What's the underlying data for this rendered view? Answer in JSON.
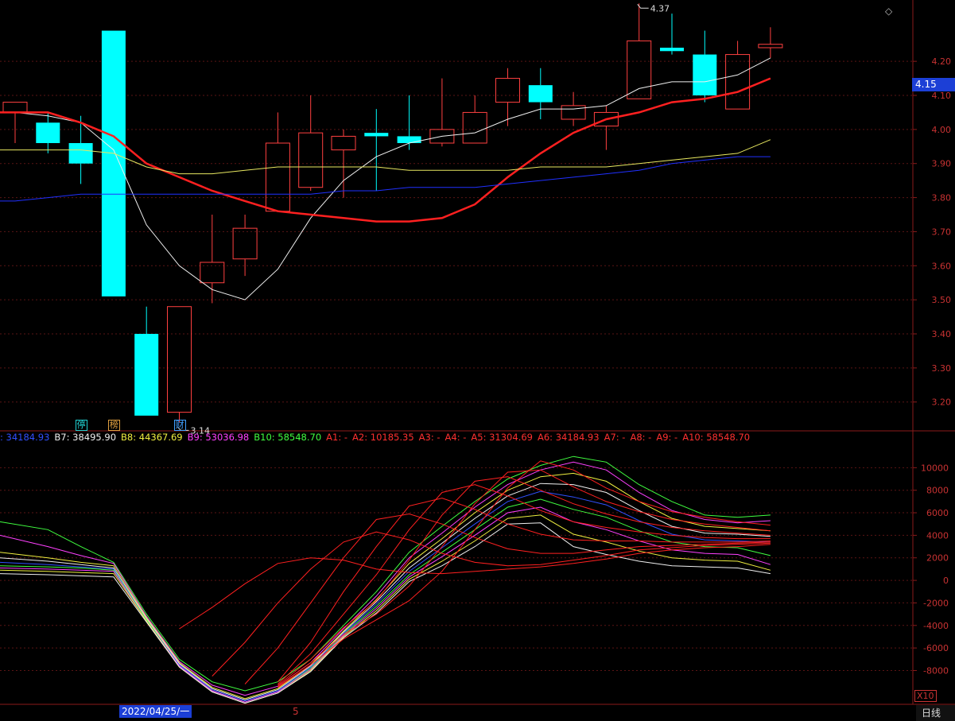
{
  "chart_data": [
    {
      "type": "candlestick",
      "y_ticks": [
        "4.20",
        "4.10",
        "4.00",
        "3.90",
        "3.80",
        "3.70",
        "3.60",
        "3.50",
        "3.40",
        "3.30",
        "3.20"
      ],
      "ylim": [
        3.12,
        4.38
      ],
      "current_price": "4.15",
      "high_label": "4.37",
      "low_label": "3.14",
      "candles": [
        {
          "o": 4.05,
          "h": 4.08,
          "l": 3.96,
          "c": 4.08,
          "up": true
        },
        {
          "o": 4.02,
          "h": 4.05,
          "l": 3.93,
          "c": 3.96,
          "up": false
        },
        {
          "o": 3.96,
          "h": 4.04,
          "l": 3.84,
          "c": 3.9,
          "up": false
        },
        {
          "o": 4.29,
          "h": 4.29,
          "l": 3.51,
          "c": 3.51,
          "up": false
        },
        {
          "o": 3.4,
          "h": 3.48,
          "l": 3.16,
          "c": 3.16,
          "up": false
        },
        {
          "o": 3.17,
          "h": 3.48,
          "l": 3.14,
          "c": 3.48,
          "up": true
        },
        {
          "o": 3.55,
          "h": 3.75,
          "l": 3.49,
          "c": 3.61,
          "up": true
        },
        {
          "o": 3.62,
          "h": 3.75,
          "l": 3.57,
          "c": 3.71,
          "up": true
        },
        {
          "o": 3.76,
          "h": 4.05,
          "l": 3.76,
          "c": 3.96,
          "up": true
        },
        {
          "o": 3.83,
          "h": 4.1,
          "l": 3.82,
          "c": 3.99,
          "up": true
        },
        {
          "o": 3.94,
          "h": 4.0,
          "l": 3.8,
          "c": 3.98,
          "up": true
        },
        {
          "o": 3.99,
          "h": 4.06,
          "l": 3.82,
          "c": 3.98,
          "up": false
        },
        {
          "o": 3.98,
          "h": 4.1,
          "l": 3.94,
          "c": 3.96,
          "up": false
        },
        {
          "o": 3.96,
          "h": 4.15,
          "l": 3.95,
          "c": 4.0,
          "up": true
        },
        {
          "o": 3.96,
          "h": 4.1,
          "l": 3.96,
          "c": 4.05,
          "up": true
        },
        {
          "o": 4.08,
          "h": 4.18,
          "l": 4.01,
          "c": 4.15,
          "up": true
        },
        {
          "o": 4.13,
          "h": 4.18,
          "l": 4.03,
          "c": 4.08,
          "up": false
        },
        {
          "o": 4.03,
          "h": 4.11,
          "l": 4.01,
          "c": 4.07,
          "up": true
        },
        {
          "o": 4.01,
          "h": 4.07,
          "l": 3.94,
          "c": 4.05,
          "up": true
        },
        {
          "o": 4.09,
          "h": 4.37,
          "l": 4.09,
          "c": 4.26,
          "up": true
        },
        {
          "o": 4.24,
          "h": 4.34,
          "l": 4.22,
          "c": 4.23,
          "up": false
        },
        {
          "o": 4.22,
          "h": 4.29,
          "l": 4.08,
          "c": 4.1,
          "up": false
        },
        {
          "o": 4.06,
          "h": 4.26,
          "l": 4.06,
          "c": 4.22,
          "up": true
        },
        {
          "o": 4.24,
          "h": 4.3,
          "l": 4.21,
          "c": 4.25,
          "up": true
        }
      ],
      "ma": [
        {
          "color": "#f0f0f0",
          "width": 1,
          "values": [
            4.05,
            4.04,
            4.02,
            3.94,
            3.72,
            3.6,
            3.53,
            3.5,
            3.59,
            3.74,
            3.85,
            3.92,
            3.96,
            3.98,
            3.99,
            4.03,
            4.06,
            4.06,
            4.07,
            4.12,
            4.14,
            4.14,
            4.16,
            4.21
          ]
        },
        {
          "color": "#ff2020",
          "width": 2.5,
          "values": [
            4.05,
            4.05,
            4.02,
            3.98,
            3.9,
            3.86,
            3.82,
            3.79,
            3.76,
            3.75,
            3.74,
            3.73,
            3.73,
            3.74,
            3.78,
            3.86,
            3.93,
            3.99,
            4.03,
            4.05,
            4.08,
            4.09,
            4.11,
            4.15
          ]
        },
        {
          "color": "#e8e860",
          "width": 1,
          "values": [
            3.94,
            3.94,
            3.94,
            3.93,
            3.89,
            3.87,
            3.87,
            3.88,
            3.89,
            3.89,
            3.89,
            3.89,
            3.88,
            3.88,
            3.88,
            3.88,
            3.89,
            3.89,
            3.89,
            3.9,
            3.91,
            3.92,
            3.93,
            3.97
          ]
        },
        {
          "color": "#2030ff",
          "width": 1,
          "values": [
            3.79,
            3.8,
            3.81,
            3.81,
            3.81,
            3.81,
            3.81,
            3.81,
            3.81,
            3.81,
            3.82,
            3.82,
            3.83,
            3.83,
            3.83,
            3.84,
            3.85,
            3.86,
            3.87,
            3.88,
            3.9,
            3.91,
            3.92,
            3.92
          ]
        }
      ],
      "badges": [
        {
          "text": "停",
          "idx": 2,
          "color": "#20d0d0"
        },
        {
          "text": "榜",
          "idx": 3,
          "color": "#e0a040"
        },
        {
          "text": "财",
          "idx": 5,
          "color": "#40a0ff"
        }
      ]
    },
    {
      "type": "line",
      "y_ticks": [
        "10000",
        "8000",
        "6000",
        "4000",
        "2000",
        "0",
        "-2000",
        "-4000",
        "-6000",
        "-8000"
      ],
      "ylim": [
        -11000,
        12000
      ],
      "multiplier": "X10",
      "legend": [
        {
          "text": ": 34184.93",
          "color": "#3050ff"
        },
        {
          "text": "B7: 38495.90",
          "color": "#f0f0f0"
        },
        {
          "text": "B8: 44367.69",
          "color": "#f0f040"
        },
        {
          "text": "B9: 53036.98",
          "color": "#ff40ff"
        },
        {
          "text": "B10: 58548.70",
          "color": "#40ff40"
        },
        {
          "text": "A1: -",
          "color": "#ff3030"
        },
        {
          "text": "A2: 10185.35",
          "color": "#ff3030"
        },
        {
          "text": "A3: -",
          "color": "#ff3030"
        },
        {
          "text": "A4: -",
          "color": "#ff3030"
        },
        {
          "text": "A5: 31304.69",
          "color": "#ff3030"
        },
        {
          "text": "A6: 34184.93",
          "color": "#ff3030"
        },
        {
          "text": "A7: -",
          "color": "#ff3030"
        },
        {
          "text": "A8: -",
          "color": "#ff3030"
        },
        {
          "text": "A9: -",
          "color": "#ff3030"
        },
        {
          "text": "A10: 58548.70",
          "color": "#ff3030"
        }
      ],
      "series": [
        {
          "color": "#40ff40",
          "values": [
            5200,
            4500,
            3000,
            1600,
            -3000,
            -7000,
            -9000,
            -9800,
            -9000,
            -7000,
            -4000,
            -1000,
            2500,
            4800,
            7000,
            9000,
            10200,
            11000,
            10500,
            8500,
            7000,
            5800,
            5600,
            5800
          ]
        },
        {
          "color": "#ff40ff",
          "values": [
            4000,
            3000,
            2200,
            1500,
            -3200,
            -7200,
            -9300,
            -10200,
            -9400,
            -7300,
            -4300,
            -1400,
            2000,
            4200,
            6500,
            8500,
            9800,
            10500,
            9800,
            7800,
            6200,
            5400,
            5100,
            5300
          ]
        },
        {
          "color": "#f0f040",
          "values": [
            2500,
            2000,
            1600,
            1300,
            -3300,
            -7300,
            -9500,
            -10500,
            -9600,
            -7500,
            -4500,
            -1700,
            1500,
            3700,
            6000,
            8000,
            9200,
            9500,
            8800,
            7000,
            5500,
            4800,
            4600,
            4400
          ]
        },
        {
          "color": "#f0f0f0",
          "values": [
            2000,
            1700,
            1400,
            1100,
            -3400,
            -7400,
            -9600,
            -10600,
            -9700,
            -7600,
            -4600,
            -1900,
            1100,
            3300,
            5500,
            7500,
            8600,
            8500,
            7800,
            6200,
            4800,
            4200,
            4100,
            3900
          ]
        },
        {
          "color": "#3050ff",
          "values": [
            1600,
            1400,
            1200,
            1000,
            -3500,
            -7500,
            -9700,
            -10700,
            -9800,
            -7700,
            -4700,
            -2100,
            800,
            2900,
            5000,
            7000,
            7900,
            7400,
            6700,
            5300,
            4100,
            3600,
            3500,
            3400
          ]
        },
        {
          "color": "#40ff40",
          "values": [
            1300,
            1200,
            1100,
            900,
            -3500,
            -7600,
            -9800,
            -10800,
            -9900,
            -7800,
            -4800,
            -2300,
            500,
            2500,
            4500,
            6500,
            7200,
            6300,
            5600,
            4400,
            3400,
            3000,
            2900,
            2200
          ]
        },
        {
          "color": "#ff40ff",
          "values": [
            1100,
            1000,
            900,
            800,
            -3600,
            -7600,
            -9800,
            -10800,
            -9900,
            -7900,
            -4900,
            -2500,
            300,
            2100,
            4000,
            6000,
            6500,
            5200,
            4500,
            3500,
            2700,
            2400,
            2300,
            1400
          ]
        },
        {
          "color": "#f0f040",
          "values": [
            900,
            800,
            700,
            600,
            -3600,
            -7700,
            -9900,
            -10900,
            -10000,
            -8000,
            -5000,
            -2700,
            100,
            1700,
            3500,
            5500,
            5800,
            4100,
            3400,
            2600,
            2000,
            1800,
            1700,
            900
          ]
        },
        {
          "color": "#f0f0f0",
          "values": [
            600,
            500,
            400,
            300,
            -3700,
            -7700,
            -9900,
            -10900,
            -10000,
            -8100,
            -5100,
            -2900,
            -100,
            1300,
            3000,
            5000,
            5100,
            3000,
            2300,
            1700,
            1300,
            1200,
            1100,
            600
          ]
        },
        {
          "color": "#ff2020",
          "values": [
            null,
            null,
            null,
            null,
            null,
            -4300,
            -2400,
            -300,
            1500,
            2000,
            1800,
            1000,
            700,
            600,
            800,
            1000,
            1200,
            1500,
            1900,
            2400,
            2700,
            2900,
            3000,
            3200
          ]
        },
        {
          "color": "#ff2020",
          "values": [
            null,
            null,
            null,
            null,
            null,
            null,
            -8500,
            -5500,
            -2000,
            1000,
            3400,
            4300,
            3600,
            2400,
            1600,
            1300,
            1400,
            1800,
            2200,
            2700,
            2900,
            3100,
            3200,
            3300
          ]
        },
        {
          "color": "#ff2020",
          "values": [
            null,
            null,
            null,
            null,
            null,
            null,
            null,
            -9200,
            -6000,
            -2000,
            2000,
            5400,
            5900,
            5000,
            3800,
            2800,
            2400,
            2400,
            2700,
            3000,
            3100,
            3200,
            3300,
            3400
          ]
        },
        {
          "color": "#ff2020",
          "values": [
            null,
            null,
            null,
            null,
            null,
            null,
            null,
            null,
            -9000,
            -5500,
            -1000,
            3000,
            6600,
            7300,
            6300,
            5000,
            4100,
            3600,
            3500,
            3500,
            3400,
            3400,
            3400,
            3500
          ]
        },
        {
          "color": "#ff2020",
          "values": [
            null,
            null,
            null,
            null,
            null,
            null,
            null,
            null,
            -9200,
            -6500,
            -3000,
            500,
            4500,
            7800,
            8500,
            7500,
            6200,
            5200,
            4700,
            4300,
            4000,
            3800,
            3700,
            3700
          ]
        },
        {
          "color": "#ff2020",
          "values": [
            null,
            null,
            null,
            null,
            null,
            null,
            null,
            null,
            -9300,
            -7000,
            -4200,
            -1800,
            1800,
            5800,
            8800,
            9200,
            8000,
            6800,
            5900,
            5200,
            4700,
            4400,
            4200,
            4000
          ]
        },
        {
          "color": "#ff2020",
          "values": [
            null,
            null,
            null,
            null,
            null,
            null,
            null,
            null,
            -9400,
            -7300,
            -4800,
            -3000,
            -500,
            3000,
            6800,
            9600,
            9800,
            8300,
            7000,
            6100,
            5400,
            5000,
            4700,
            4400
          ]
        },
        {
          "color": "#ff2020",
          "values": [
            null,
            null,
            null,
            null,
            null,
            null,
            null,
            null,
            -9500,
            -7500,
            -5200,
            -3500,
            -1800,
            800,
            4500,
            8200,
            10600,
            9800,
            8200,
            7000,
            6100,
            5600,
            5200,
            4900
          ]
        }
      ]
    }
  ],
  "footer": {
    "date_label": "2022/04/25/一",
    "month_marker": "5",
    "period_label": "日线"
  }
}
